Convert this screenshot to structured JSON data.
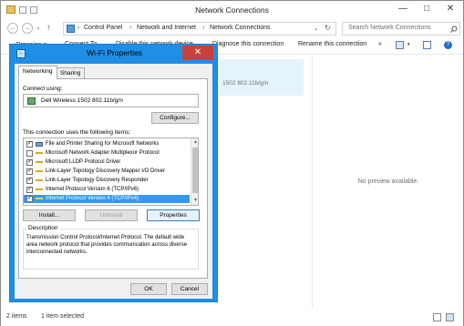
{
  "window": {
    "title": "Network Connections",
    "minimize_glyph": "—",
    "maximize_glyph": "□",
    "close_glyph": "✕"
  },
  "nav": {
    "back_glyph": "←",
    "forward_glyph": "→",
    "recent_glyph": "⌄",
    "up_glyph": "↑",
    "breadcrumb": [
      "Control Panel",
      "Network and Internet",
      "Network Connections"
    ],
    "separator": "›",
    "refresh_glyph": "↻",
    "dropdown_glyph": "⌄",
    "search_placeholder": "Search Network Connections",
    "search_icon": "search-icon"
  },
  "commands": {
    "items": [
      "Organize ▾",
      "Connect To",
      "Disable this network device",
      "Diagnose this connection",
      "Rename this connection"
    ],
    "more": "»"
  },
  "content": {
    "item_subtitle": "1502 802.11b/g/n",
    "preview_text": "No preview available."
  },
  "status": {
    "count": "2 items",
    "selected": "1 item selected"
  },
  "dialog": {
    "title": "Wi-Fi Properties",
    "close_glyph": "✕",
    "tabs": [
      "Networking",
      "Sharing"
    ],
    "connect_using_label": "Connect using:",
    "adapter": "Dell Wireless 1502 802.11b/g/n",
    "configure_button": "Configure...",
    "items_label": "This connection uses the following items:",
    "items": [
      {
        "label": "File and Printer Sharing for Microsoft Networks",
        "checked": true,
        "icon": "service-icon"
      },
      {
        "label": "Microsoft Network Adapter Multiplexor Protocol",
        "checked": false,
        "icon": "protocol-icon"
      },
      {
        "label": "Microsoft LLDP Protocol Driver",
        "checked": true,
        "icon": "protocol-icon"
      },
      {
        "label": "Link-Layer Topology Discovery Mapper I/O Driver",
        "checked": true,
        "icon": "protocol-icon"
      },
      {
        "label": "Link-Layer Topology Discovery Responder",
        "checked": true,
        "icon": "protocol-icon"
      },
      {
        "label": "Internet Protocol Version 6 (TCP/IPv6)",
        "checked": true,
        "icon": "protocol-icon"
      },
      {
        "label": "Internet Protocol Version 4 (TCP/IPv4)",
        "checked": true,
        "icon": "protocol-icon",
        "selected": true
      }
    ],
    "install_button": "Install...",
    "uninstall_button": "Uninstall",
    "properties_button": "Properties",
    "description_label": "Description",
    "description_text": "Transmission Control Protocol/Internet Protocol. The default wide area network protocol that provides communication across diverse interconnected networks.",
    "ok_button": "OK",
    "cancel_button": "Cancel"
  },
  "colors": {
    "accent": "#1f8ee6",
    "selection": "#3399ff",
    "close_red": "#c7433a"
  }
}
